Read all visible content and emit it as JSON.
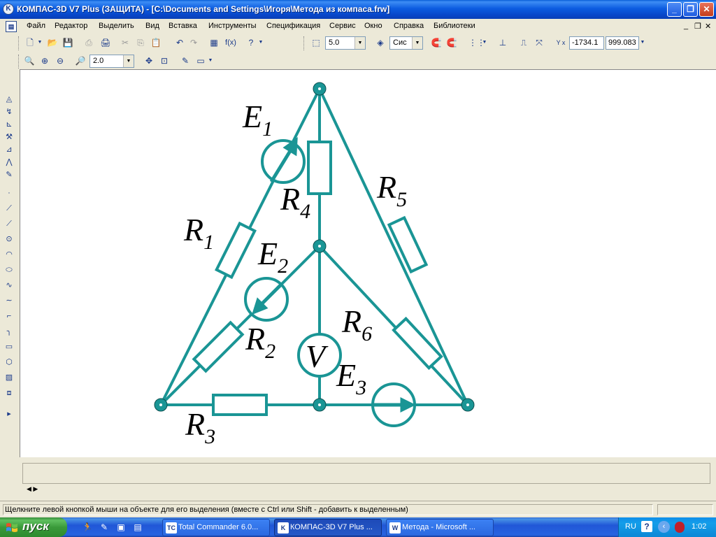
{
  "window": {
    "title": "КОМПАС-3D V7 Plus (ЗАЩИТА) - [C:\\Documents and Settings\\Игоря\\Метода из компаса.frw]",
    "app_icon_letter": "K",
    "minimize": "_",
    "maximize": "❐",
    "close": "✕"
  },
  "menu": {
    "items": [
      "Файл",
      "Редактор",
      "Выделить",
      "Вид",
      "Вставка",
      "Инструменты",
      "Спецификация",
      "Сервис",
      "Окно",
      "Справка",
      "Библиотеки"
    ],
    "mdi_minimize": "_",
    "mdi_restore": "❐",
    "mdi_close": "✕"
  },
  "toolbar1": {
    "step_value": "5.0",
    "layer_combo": "Сис",
    "fx_label": "f(x)",
    "coord_x": "-1734.1",
    "coord_y": "999.083"
  },
  "toolbar2": {
    "zoom_value": "2.0"
  },
  "drawing": {
    "labels": {
      "E1": {
        "main": "E",
        "sub": "1"
      },
      "E2": {
        "main": "E",
        "sub": "2"
      },
      "E3": {
        "main": "E",
        "sub": "3"
      },
      "R1": {
        "main": "R",
        "sub": "1"
      },
      "R2": {
        "main": "R",
        "sub": "2"
      },
      "R3": {
        "main": "R",
        "sub": "3"
      },
      "R4": {
        "main": "R",
        "sub": "4"
      },
      "R5": {
        "main": "R",
        "sub": "5"
      },
      "R6": {
        "main": "R",
        "sub": "6"
      },
      "V": "V"
    },
    "stroke_color": "#1a9595"
  },
  "status": {
    "message": "Щелкните левой кнопкой мыши на объекте для его выделения (вместе с Ctrl или Shift - добавить к выделенным)"
  },
  "taskbar": {
    "start_label": "пуск",
    "tasks": [
      {
        "label": "Total Commander 6.0...",
        "icon": "TC"
      },
      {
        "label": "КОМПАС-3D V7 Plus ...",
        "icon": "K",
        "active": true
      },
      {
        "label": "Метода - Microsoft ...",
        "icon": "W"
      }
    ],
    "lang": "RU",
    "help": "?",
    "clock": "1:02"
  },
  "colors": {
    "titlebar": "#0a5fd8",
    "circuit": "#1a9595",
    "taskbar": "#2458c8",
    "start": "#3a9a3a"
  }
}
